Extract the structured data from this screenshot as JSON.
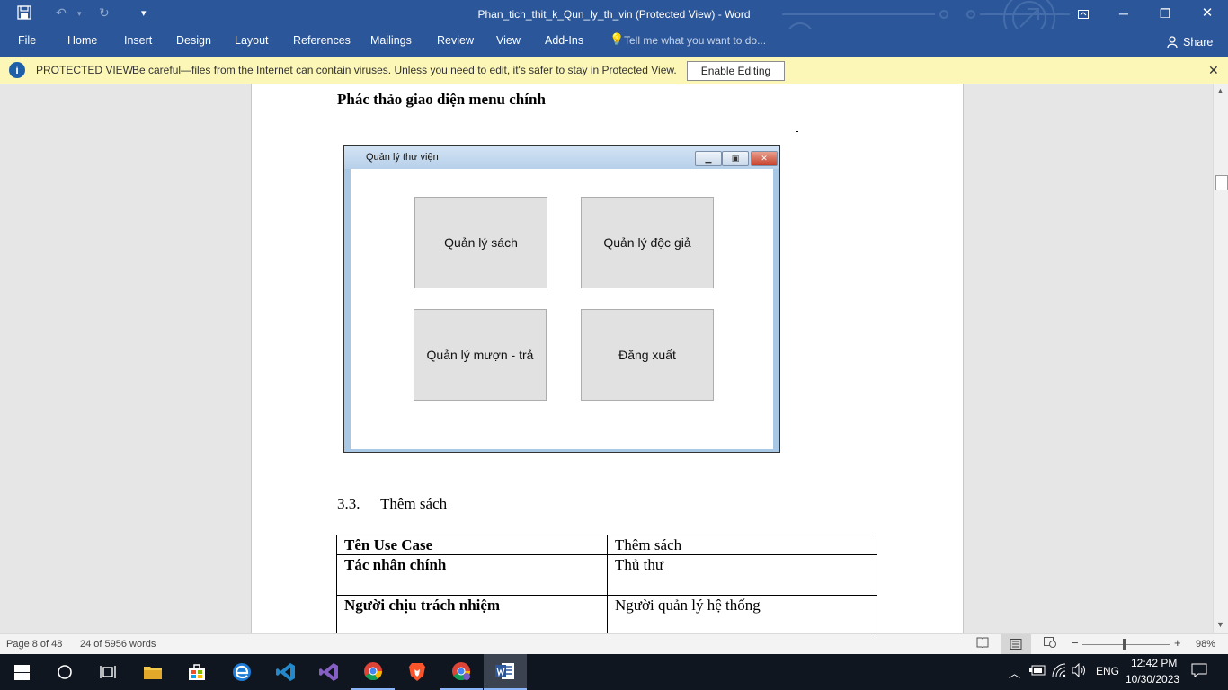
{
  "window": {
    "title": "Phan_tich_thit_k_Qun_ly_th_vin (Protected View) - Word",
    "min_glyph": "─",
    "restore_glyph": "❐",
    "close_glyph": "✕"
  },
  "quick_access": {
    "save_glyph": "💾",
    "undo_glyph": "↶",
    "redo_glyph": "↻",
    "customize_glyph": "▾"
  },
  "ribbon": {
    "tabs": [
      "File",
      "Home",
      "Insert",
      "Design",
      "Layout",
      "References",
      "Mailings",
      "Review",
      "View",
      "Add-Ins"
    ],
    "tell_me_placeholder": "Tell me what you want to do...",
    "share_label": "Share"
  },
  "protected_view": {
    "label": "PROTECTED VIEW",
    "message": "Be careful—files from the Internet can contain viruses. Unless you need to edit, it's safer to stay in Protected View.",
    "enable_button": "Enable Editing",
    "close_glyph": "✕"
  },
  "document": {
    "heading": "Phác thảo giao diện menu chính",
    "mock_window": {
      "title": "Quản lý thư viện",
      "buttons": [
        "Quản lý sách",
        "Quản lý độc giả",
        "Quản lý mượn - trả",
        "Đăng xuất"
      ]
    },
    "section_number": "3.3.",
    "section_title": "Thêm sách",
    "table": [
      [
        "Tên Use Case",
        "Thêm sách"
      ],
      [
        "Tác nhân chính",
        "Thủ thư"
      ],
      [
        "Người chịu trách nhiệm",
        "Người quản lý hệ thống"
      ]
    ]
  },
  "status_bar": {
    "page": "Page 8 of 48",
    "words": "24 of 5956 words",
    "zoom": "98%",
    "zoom_level_percent": 98
  },
  "taskbar": {
    "lang": "ENG",
    "time": "12:42 PM",
    "date": "10/30/2023"
  },
  "colors": {
    "word_blue": "#2b579a",
    "protected_yellow": "#fcf7b6",
    "taskbar": "#101620"
  }
}
